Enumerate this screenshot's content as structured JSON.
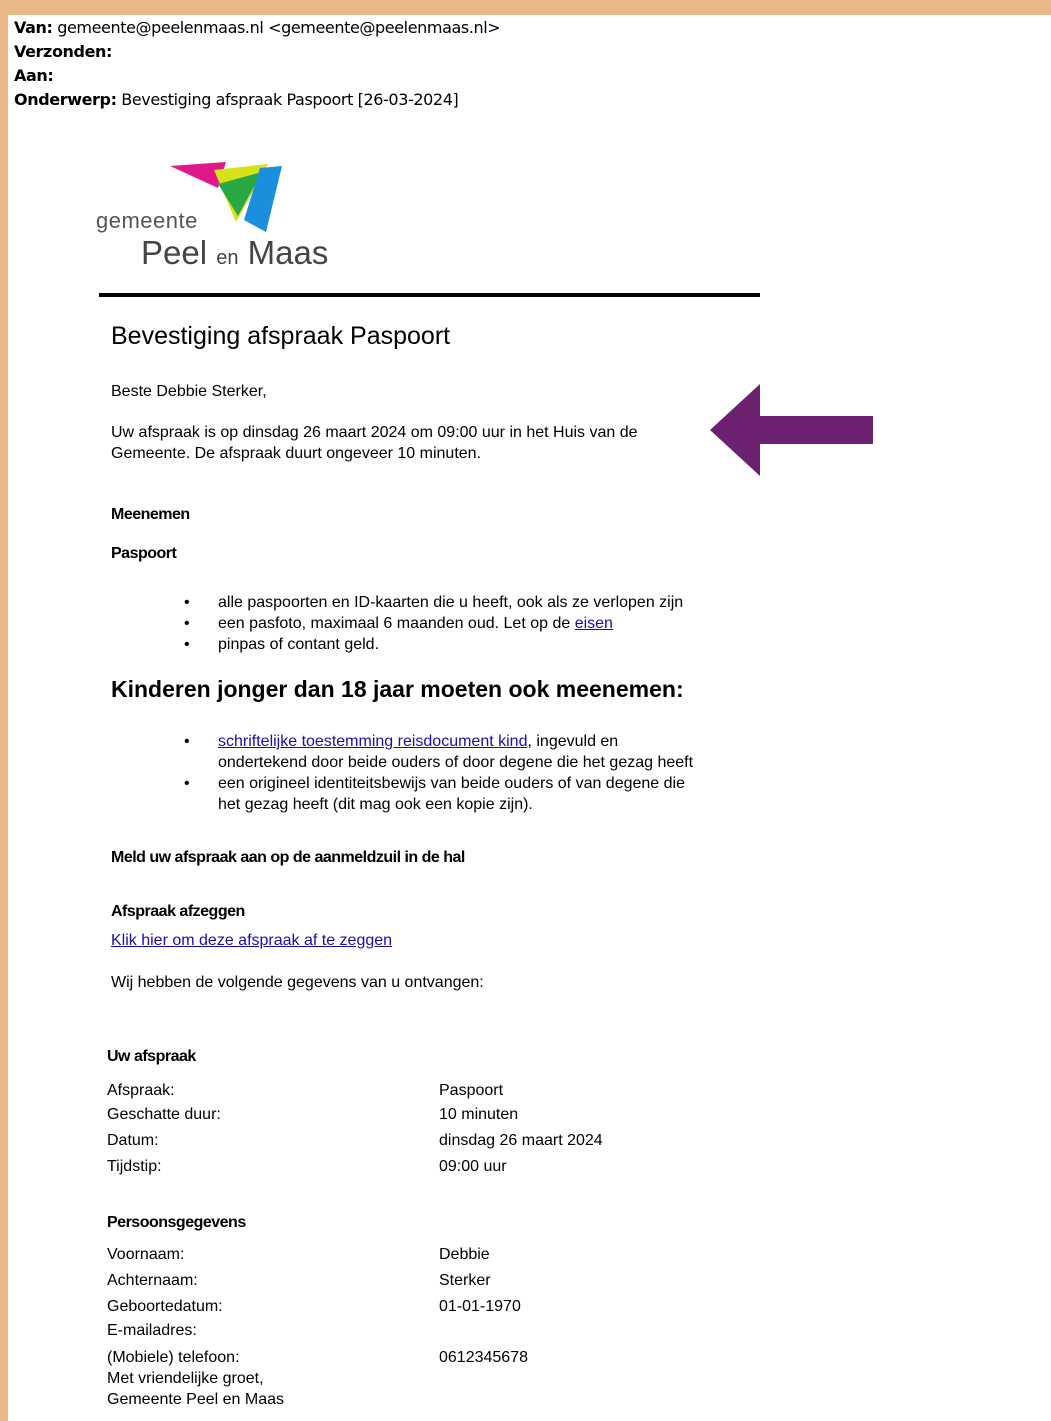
{
  "email_header": {
    "from_label": "Van:",
    "from_value": "gemeente@peelenmaas.nl <gemeente@peelenmaas.nl>",
    "sent_label": "Verzonden:",
    "to_label": "Aan:",
    "subject_label": "Onderwerp:",
    "subject_value": "Bevestiging afspraak Paspoort [26-03-2024]"
  },
  "logo": {
    "line1": "gemeente",
    "word_a": "Peel",
    "word_en": "en",
    "word_b": "Maas",
    "colors": {
      "magenta": "#e0198a",
      "yellow": "#d6e11c",
      "green": "#2aa843",
      "blue": "#1b8fdc"
    }
  },
  "title": "Bevestiging afspraak Paspoort",
  "greeting": "Beste Debbie Sterker,",
  "intro_line1": "Uw afspraak is op dinsdag 26 maart 2024 om 09:00 uur in het Huis van de",
  "intro_line2": "Gemeente.  De afspraak duurt ongeveer 10 minuten.",
  "arrow_color": "#6b2170",
  "meenemen": {
    "heading": "Meenemen",
    "subheading": "Paspoort",
    "items": [
      "alle paspoorten en ID-kaarten die u heeft, ook als ze verlopen zijn",
      "een pasfoto, maximaal 6 maanden oud. Let op de",
      "pinpas of contant geld."
    ],
    "eisen_link": "eisen"
  },
  "kinderen": {
    "heading": "Kinderen jonger dan 18 jaar moeten ook meenemen:",
    "item1_link": "schriftelijke toestemming reisdocument kind",
    "item1_rest": ", ingevuld en",
    "item1_line2": "ondertekend door beide ouders of door degene die het gezag heeft",
    "item2_line1": "een origineel identiteitsbewijs van beide ouders of van degene die",
    "item2_line2": "het gezag heeft (dit mag ook een kopie zijn)."
  },
  "meld": "Meld uw afspraak  aan op de aanmeldzuil in de hal",
  "afzeggen": {
    "heading": "Afspraak  afzeggen",
    "link": "Klik hier om deze afspraak af te zeggen"
  },
  "gegevens_intro": "Wij hebben de volgende gegevens van u ontvangen:",
  "uw_afspraak": {
    "heading": "Uw afspraak",
    "rows": [
      {
        "label": "Afspraak:",
        "value": "Paspoort"
      },
      {
        "label": "Geschatte duur:",
        "value": "10 minuten"
      },
      {
        "label": "Datum:",
        "value": "dinsdag 26 maart 2024"
      },
      {
        "label": "Tijdstip:",
        "value": "09:00 uur"
      }
    ]
  },
  "persoonsgegevens": {
    "heading": "Persoonsgegevens",
    "rows": [
      {
        "label": "Voornaam:",
        "value": "Debbie"
      },
      {
        "label": "Achternaam:",
        "value": "Sterker"
      },
      {
        "label": "Geboortedatum:",
        "value": "01-01-1970"
      },
      {
        "label": "E-mailadres:",
        "value": ""
      },
      {
        "label": "(Mobiele) telefoon:",
        "value": "0612345678"
      }
    ]
  },
  "closing_line1": "Met vriendelijke groet,",
  "closing_line2": "Gemeente  Peel en Maas"
}
